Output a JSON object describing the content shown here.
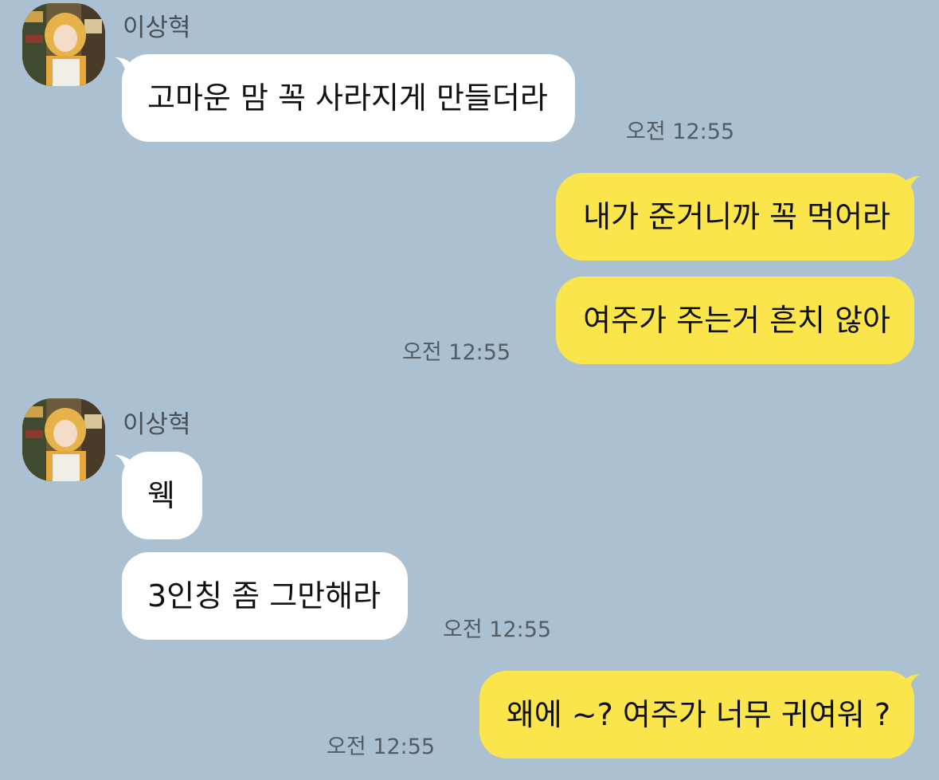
{
  "chat": {
    "messages": [
      {
        "sender": "이상혁",
        "direction": "incoming",
        "bubbles": [
          "고마운 맘 꼭 사라지게 만들더라"
        ],
        "time": "오전 12:55"
      },
      {
        "direction": "outgoing",
        "bubbles": [
          "내가 준거니까 꼭 먹어라",
          "여주가 주는거 흔치 않아"
        ],
        "time": "오전 12:55"
      },
      {
        "sender": "이상혁",
        "direction": "incoming",
        "bubbles": [
          "웩",
          "3인칭 좀 그만해라"
        ],
        "time": "오전 12:55"
      },
      {
        "direction": "outgoing",
        "bubbles": [
          "왜에 ~? 여주가 너무 귀여워 ?"
        ],
        "time": "오전 12:55"
      }
    ]
  },
  "colors": {
    "background": "#abc1d1",
    "incoming_bubble": "#ffffff",
    "outgoing_bubble": "#fae64c"
  },
  "icons": {
    "avatar": "profile-photo"
  }
}
